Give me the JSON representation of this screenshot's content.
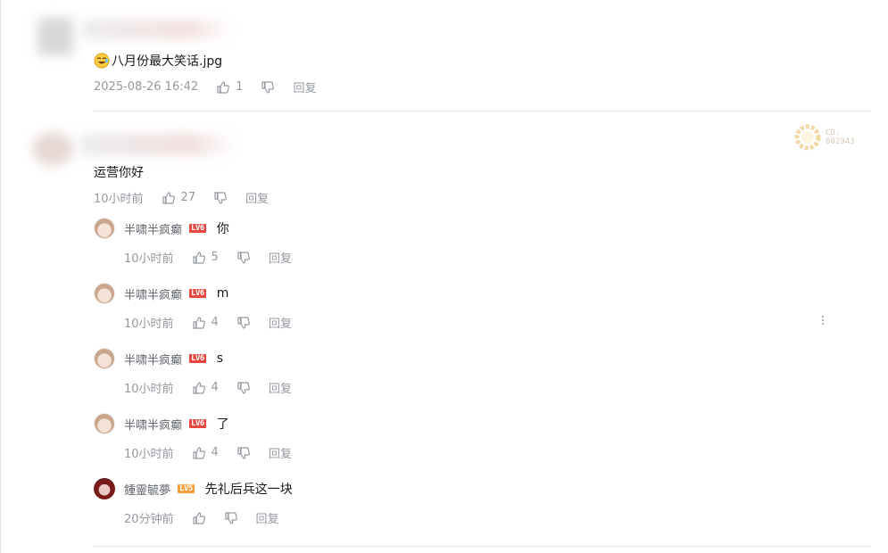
{
  "top_comment": {
    "emoji_icon": "laughing-face-icon",
    "text": "八月份最大笑话.jpg",
    "time": "2025-08-26 16:42",
    "likes": "1",
    "reply_label": "回复"
  },
  "main_comment": {
    "text": "运营你好",
    "time": "10小时前",
    "likes": "27",
    "reply_label": "回复",
    "fan_badge": {
      "line1": "CD.",
      "line2": "002943"
    }
  },
  "replies": [
    {
      "user": "半啸半疯癫",
      "level": "LV6",
      "level_color": "#e8463f",
      "text": "你",
      "time": "10小时前",
      "likes": "5",
      "reply_label": "回复"
    },
    {
      "user": "半啸半疯癫",
      "level": "LV6",
      "level_color": "#e8463f",
      "text": "m",
      "time": "10小时前",
      "likes": "4",
      "reply_label": "回复"
    },
    {
      "user": "半啸半疯癫",
      "level": "LV6",
      "level_color": "#e8463f",
      "text": "s",
      "time": "10小时前",
      "likes": "4",
      "reply_label": "回复"
    },
    {
      "user": "半啸半疯癫",
      "level": "LV6",
      "level_color": "#e8463f",
      "text": "了",
      "time": "10小时前",
      "likes": "4",
      "reply_label": "回复"
    },
    {
      "user": "鍾靈毓夢",
      "level": "LV5",
      "level_color": "#ff9e3a",
      "text": "先礼后兵这一块",
      "time": "20分钟前",
      "likes": "",
      "reply_label": "回复"
    }
  ]
}
